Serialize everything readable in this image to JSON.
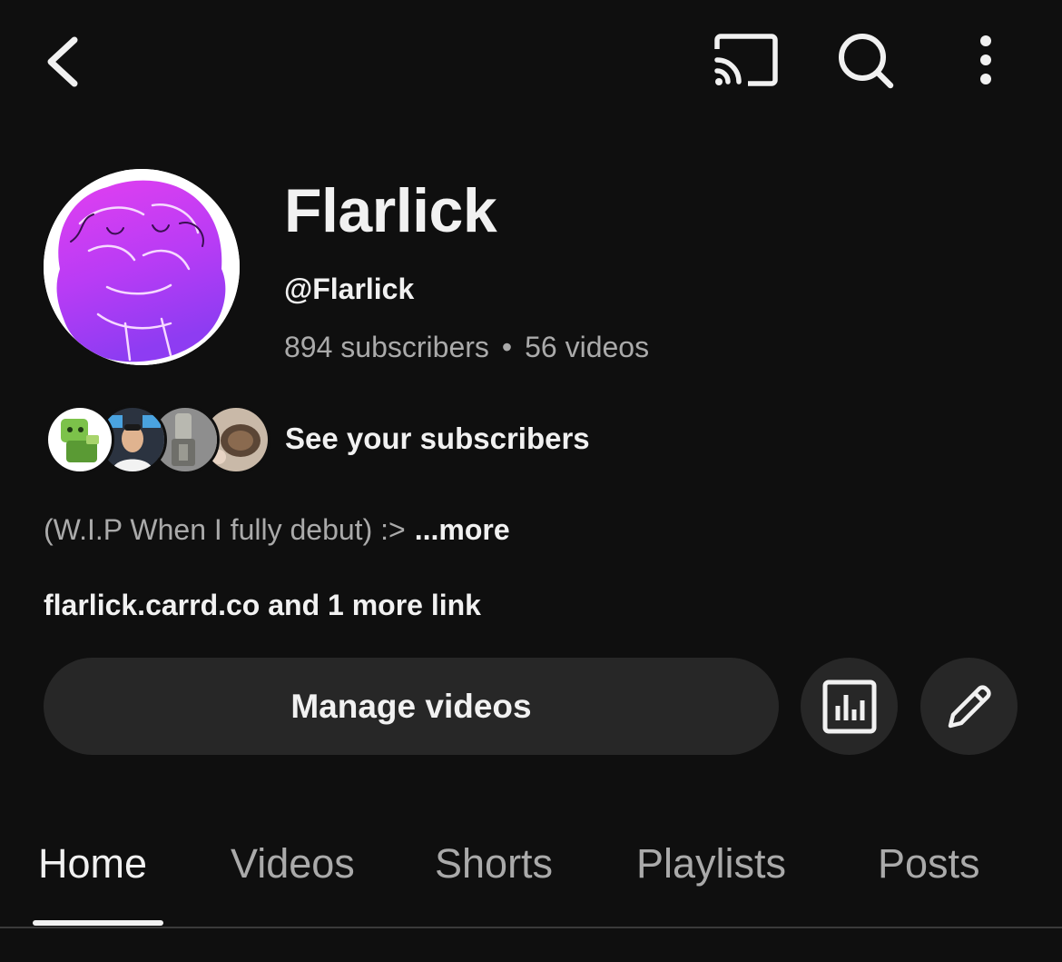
{
  "channel": {
    "name": "Flarlick",
    "handle": "@Flarlick",
    "subscribers": "894 subscribers",
    "separator": "•",
    "videos": "56 videos"
  },
  "subscribers_preview": {
    "label": "See your subscribers"
  },
  "description": {
    "text": "(W.I.P When I fully debut) :>",
    "more_label": "...more"
  },
  "links": {
    "text": "flarlick.carrd.co and 1 more link"
  },
  "actions": {
    "manage_label": "Manage videos"
  },
  "tabs": [
    {
      "label": "Home",
      "active": true
    },
    {
      "label": "Videos",
      "active": false
    },
    {
      "label": "Shorts",
      "active": false
    },
    {
      "label": "Playlists",
      "active": false
    },
    {
      "label": "Posts",
      "active": false
    }
  ],
  "icons": {
    "back": "chevron-left-icon",
    "cast": "cast-icon",
    "search": "search-icon",
    "more": "more-vertical-icon",
    "analytics": "analytics-icon",
    "edit": "pencil-icon"
  },
  "colors": {
    "background": "#0f0f0f",
    "button_bg": "#272727",
    "text_primary": "#f1f1f1",
    "text_secondary": "#aaaaaa",
    "avatar_purple": "#c13cf0"
  }
}
